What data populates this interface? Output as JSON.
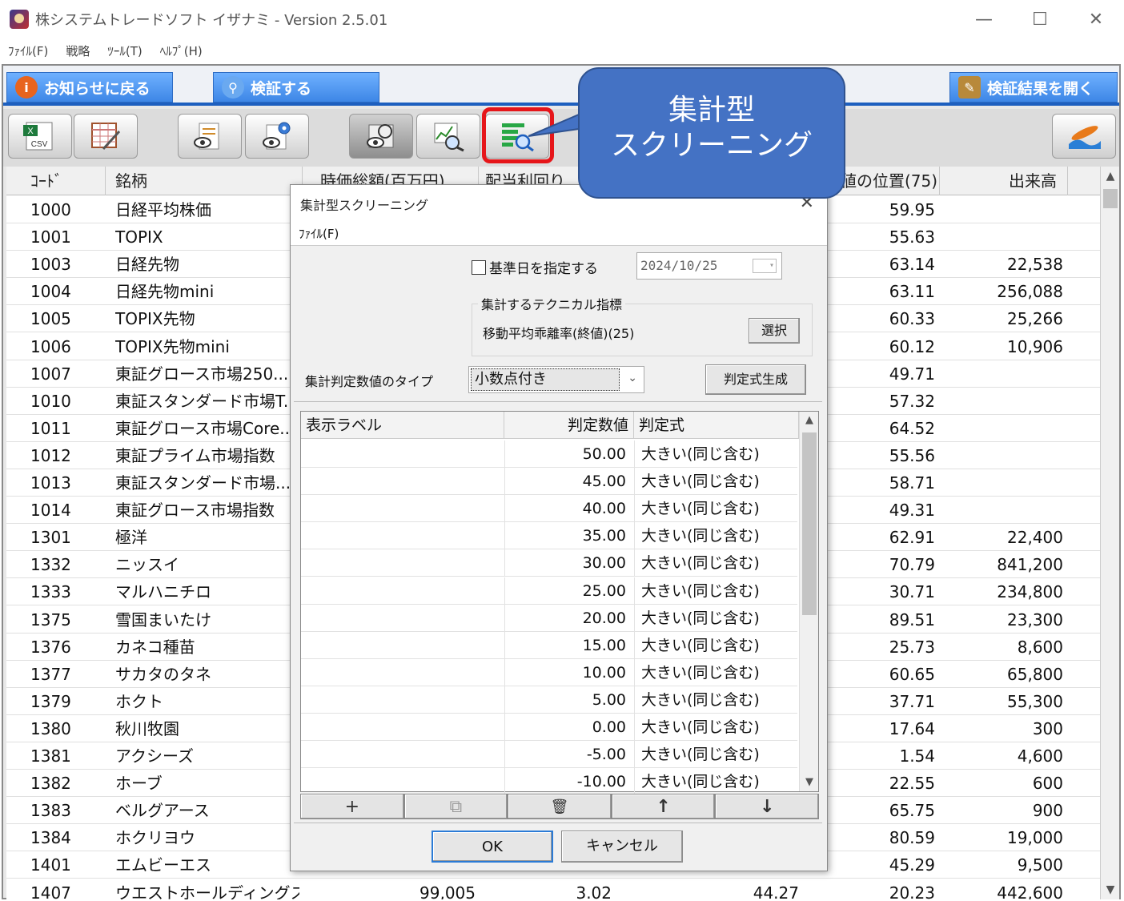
{
  "window": {
    "title": "株システムトレードソフト イザナミ - Version 2.5.01",
    "minimize": "—",
    "maximize": "☐",
    "close": "✕"
  },
  "menu": [
    "ﾌｧｲﾙ(F)",
    "戦略",
    "ﾂｰﾙ(T)",
    "ﾍﾙﾌﾟ(H)"
  ],
  "actions": {
    "back": "お知らせに戻る",
    "verify": "検証する",
    "open_results": "検証結果を開く"
  },
  "toolbar_icons": [
    "csv-export-icon",
    "table-edit-icon",
    "view-list-icon",
    "view-settings-icon",
    "chart-refresh-icon",
    "chart-search-icon",
    "aggregate-screening-icon",
    "surfing-icon"
  ],
  "table": {
    "headers": [
      "ｺｰﾄﾞ",
      "銘柄",
      "時価総額(百万円)",
      "配当利回り",
      "",
      "値の位置(75)",
      "出来高"
    ],
    "rows": [
      {
        "code": "1000",
        "name": "日経平均株価",
        "pos": "59.95",
        "vol": ""
      },
      {
        "code": "1001",
        "name": "TOPIX",
        "pos": "55.63",
        "vol": ""
      },
      {
        "code": "1003",
        "name": "日経先物",
        "pos": "63.14",
        "vol": "22,538"
      },
      {
        "code": "1004",
        "name": "日経先物mini",
        "pos": "63.11",
        "vol": "256,088"
      },
      {
        "code": "1005",
        "name": "TOPIX先物",
        "pos": "60.33",
        "vol": "25,266"
      },
      {
        "code": "1006",
        "name": "TOPIX先物mini",
        "pos": "60.12",
        "vol": "10,906"
      },
      {
        "code": "1007",
        "name": "東証グロース市場250...",
        "pos": "49.71",
        "vol": ""
      },
      {
        "code": "1010",
        "name": "東証スタンダード市場T...",
        "pos": "57.32",
        "vol": ""
      },
      {
        "code": "1011",
        "name": "東証グロース市場Core...",
        "pos": "64.52",
        "vol": ""
      },
      {
        "code": "1012",
        "name": "東証プライム市場指数",
        "pos": "55.56",
        "vol": ""
      },
      {
        "code": "1013",
        "name": "東証スタンダード市場...",
        "pos": "58.71",
        "vol": ""
      },
      {
        "code": "1014",
        "name": "東証グロース市場指数",
        "pos": "49.31",
        "vol": ""
      },
      {
        "code": "1301",
        "name": "極洋",
        "pos": "62.91",
        "vol": "22,400"
      },
      {
        "code": "1332",
        "name": "ニッスイ",
        "pos": "70.79",
        "vol": "841,200"
      },
      {
        "code": "1333",
        "name": "マルハニチロ",
        "pos": "30.71",
        "vol": "234,800"
      },
      {
        "code": "1375",
        "name": "雪国まいたけ",
        "pos": "89.51",
        "vol": "23,300"
      },
      {
        "code": "1376",
        "name": "カネコ種苗",
        "pos": "25.73",
        "vol": "8,600"
      },
      {
        "code": "1377",
        "name": "サカタのタネ",
        "pos": "60.65",
        "vol": "65,800"
      },
      {
        "code": "1379",
        "name": "ホクト",
        "pos": "37.71",
        "vol": "55,300"
      },
      {
        "code": "1380",
        "name": "秋川牧園",
        "pos": "17.64",
        "vol": "300"
      },
      {
        "code": "1381",
        "name": "アクシーズ",
        "pos": "1.54",
        "vol": "4,600"
      },
      {
        "code": "1382",
        "name": "ホーブ",
        "pos": "22.55",
        "vol": "600"
      },
      {
        "code": "1383",
        "name": "ベルグアース",
        "pos": "65.75",
        "vol": "900"
      },
      {
        "code": "1384",
        "name": "ホクリヨウ",
        "pos": "80.59",
        "vol": "19,000"
      },
      {
        "code": "1401",
        "name": "エムビーエス",
        "pos": "45.29",
        "vol": "9,500"
      },
      {
        "code": "1407",
        "name": "ウエストホールディングス",
        "v1": "99,005",
        "v2": "3.02",
        "v3": "44.27",
        "pos": "20.23",
        "vol": "442,600"
      }
    ]
  },
  "dialog": {
    "title": "集計型スクリーニング",
    "close": "✕",
    "menu": "ﾌｧｲﾙ(F)",
    "base_date_label": "基準日を指定する",
    "base_date_value": "2024/10/25",
    "indicator_group_label": "集計するテクニカル指標",
    "indicator_value": "移動平均乖離率(終値)(25)",
    "select_button": "選択",
    "type_label": "集計判定数値のタイプ",
    "type_value": "小数点付き",
    "generate_button": "判定式生成",
    "list_headers": [
      "表示ラベル",
      "判定数値",
      "判定式"
    ],
    "list_rows": [
      {
        "label": "",
        "value": "50.00",
        "expr": "大きい(同じ含む)"
      },
      {
        "label": "",
        "value": "45.00",
        "expr": "大きい(同じ含む)"
      },
      {
        "label": "",
        "value": "40.00",
        "expr": "大きい(同じ含む)"
      },
      {
        "label": "",
        "value": "35.00",
        "expr": "大きい(同じ含む)"
      },
      {
        "label": "",
        "value": "30.00",
        "expr": "大きい(同じ含む)"
      },
      {
        "label": "",
        "value": "25.00",
        "expr": "大きい(同じ含む)"
      },
      {
        "label": "",
        "value": "20.00",
        "expr": "大きい(同じ含む)"
      },
      {
        "label": "",
        "value": "15.00",
        "expr": "大きい(同じ含む)"
      },
      {
        "label": "",
        "value": "10.00",
        "expr": "大きい(同じ含む)"
      },
      {
        "label": "",
        "value": "5.00",
        "expr": "大きい(同じ含む)"
      },
      {
        "label": "",
        "value": "0.00",
        "expr": "大きい(同じ含む)"
      },
      {
        "label": "",
        "value": "-5.00",
        "expr": "大きい(同じ含む)"
      },
      {
        "label": "",
        "value": "-10.00",
        "expr": "大きい(同じ含む)"
      }
    ],
    "list_buttons": {
      "add": "+",
      "copy": "⧉",
      "delete": "🗑",
      "up": "↑",
      "down": "↓"
    },
    "ok": "OK",
    "cancel": "キャンセル"
  },
  "callout": {
    "line1": "集計型",
    "line2": "スクリーニング",
    "color": "#4472c4"
  },
  "highlight_color": "#e6161a"
}
